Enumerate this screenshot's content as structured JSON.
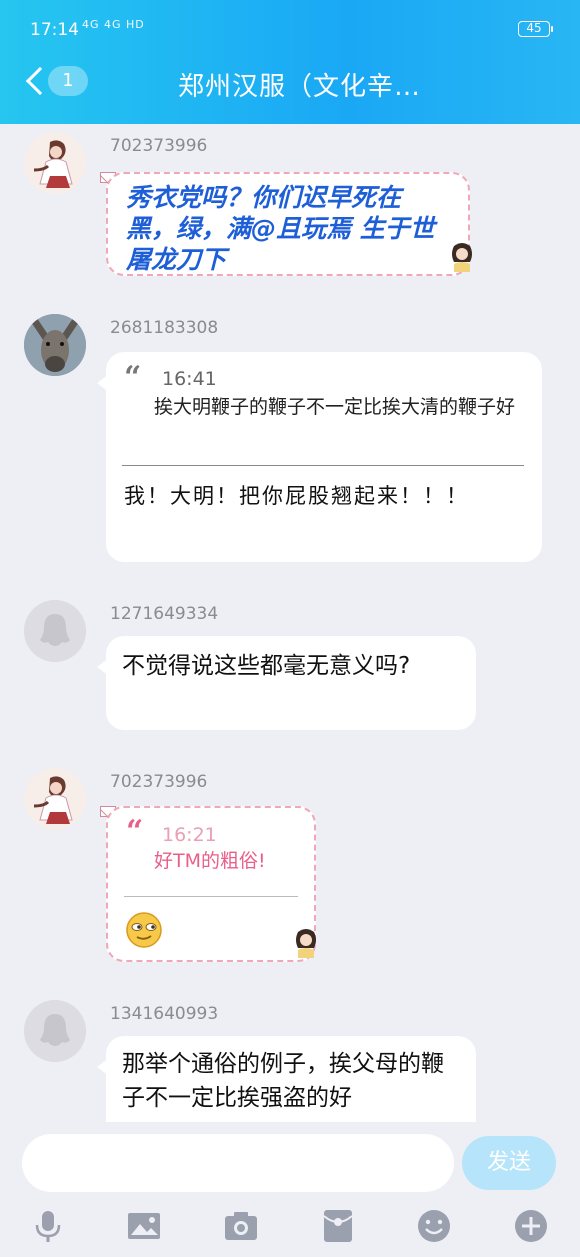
{
  "status_bar": {
    "time": "17:14",
    "signal": "4G 4G HD",
    "battery": "45"
  },
  "header": {
    "back_badge": "1",
    "title": "郑州汉服（文化辛…"
  },
  "messages": [
    {
      "uid": "702373996",
      "text": "秀衣党吗？你们迟早死在黑，绿，满@且玩焉 生于世屠龙刀下"
    },
    {
      "uid": "2681183308",
      "quote_time": "16:41",
      "quote_text": "挨大明鞭子的鞭子不一定比挨大清的鞭子好",
      "reply": "我！大明！把你屁股翘起来！！！"
    },
    {
      "uid": "1271649334",
      "text": "不觉得说这些都毫无意义吗?"
    },
    {
      "uid": "702373996",
      "quote_time": "16:21",
      "quote_text": "好TM的粗俗!",
      "emoji": "smirk-face"
    },
    {
      "uid": "1341640993",
      "text": "那举个通俗的例子，挨父母的鞭子不一定比挨强盗的好"
    }
  ],
  "input": {
    "placeholder": "",
    "send_label": "发送"
  },
  "toolbar": [
    "microphone-icon",
    "image-icon",
    "camera-icon",
    "red-packet-icon",
    "emoji-icon",
    "plus-icon"
  ],
  "colors": {
    "header": "#1aa8f5",
    "fancy_text": "#1e5fd8",
    "quote_pink": "#e8608a"
  }
}
